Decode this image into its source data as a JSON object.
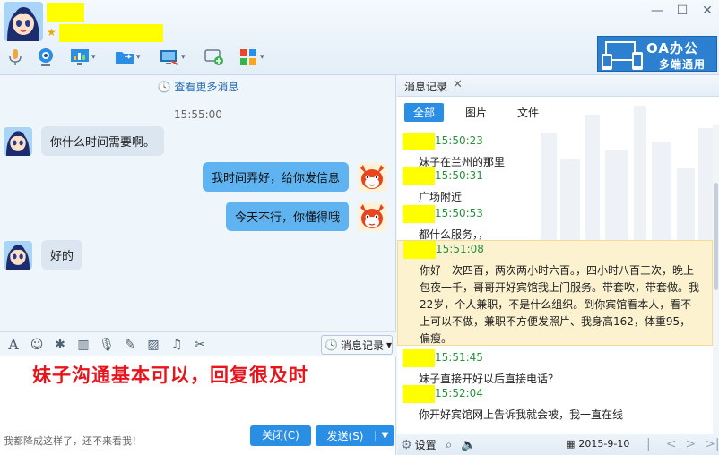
{
  "window": {
    "min": "—",
    "max": "☐",
    "close": "✕"
  },
  "toolbar": {
    "caret": "▾"
  },
  "banner": {
    "title": "OA办公",
    "subtitle": "多端通用"
  },
  "chat": {
    "more_messages": "查看更多消息",
    "timestamp": "15:55:00",
    "messages": [
      {
        "side": "in",
        "text": "你什么时间需要啊。"
      },
      {
        "side": "out",
        "text": "我时间弄好，给你发信息"
      },
      {
        "side": "out",
        "text": "今天不行，你懂得哦"
      },
      {
        "side": "in",
        "text": "好的"
      }
    ]
  },
  "input_toolbar": {
    "history_label": "消息记录",
    "caret": "▾"
  },
  "input": {
    "annotation": "妹子沟通基本可以，回复很及时",
    "hint": "我都降成这样了，还不来看我！",
    "close_label": "关闭(C)",
    "send_label": "发送(S)",
    "send_arrow": "▼"
  },
  "history": {
    "tab_label": "消息记录",
    "tab_close": "✕",
    "filters": [
      "全部",
      "图片",
      "文件"
    ],
    "entries": [
      {
        "time": "15:50:23",
        "text": "妹子在兰州的那里"
      },
      {
        "time": "15:50:31",
        "text": "广场附近"
      },
      {
        "time": "15:50:53",
        "text": "都什么服务，，"
      },
      {
        "time": "15:51:08",
        "text": "你好一次四百，两次两小时六百。，四小时八百三次，晚上包夜一千，哥哥开好宾馆我上门服务。带套吹，带套做。我22岁，个人兼职，不是什么组织。到你宾馆看本人，看不上可以不做，兼职不方便发照片、我身高162，体重95，偏瘦。"
      },
      {
        "time": "15:51:45",
        "text": "妹子直接开好以后直接电话？"
      },
      {
        "time": "15:52:04",
        "text": "你开好宾馆网上告诉我就会被，我一直在线"
      }
    ],
    "settings_label": "设置",
    "date": "2015-9-10"
  }
}
